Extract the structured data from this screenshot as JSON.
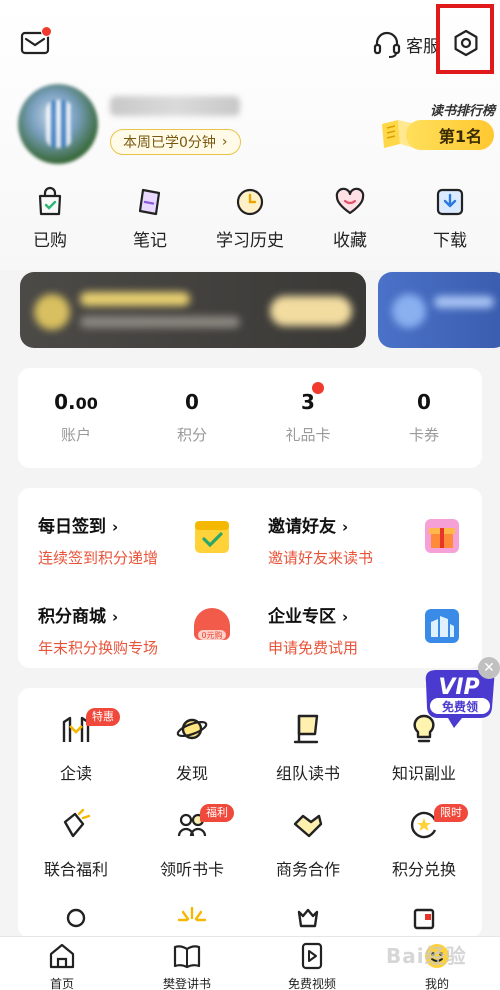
{
  "topbar": {
    "service_label": "客服"
  },
  "profile": {
    "study_time": "本周已学0分钟",
    "rank_title": "读书排行榜",
    "rank_value": "第1名"
  },
  "quick": [
    "已购",
    "笔记",
    "学习历史",
    "收藏",
    "下载"
  ],
  "account": [
    {
      "value_main": "0.",
      "value_dec": "00",
      "label": "账户"
    },
    {
      "value_main": "0",
      "value_dec": "",
      "label": "积分"
    },
    {
      "value_main": "3",
      "value_dec": "",
      "label": "礼品卡"
    },
    {
      "value_main": "0",
      "value_dec": "",
      "label": "卡券"
    }
  ],
  "features": [
    {
      "title": "每日签到",
      "subtitle": "连续签到积分递增"
    },
    {
      "title": "邀请好友",
      "subtitle": "邀请好友来读书"
    },
    {
      "title": "积分商城",
      "subtitle": "年末积分换购专场"
    },
    {
      "title": "企业专区",
      "subtitle": "申请免费试用"
    }
  ],
  "grid": [
    {
      "label": "企读",
      "tag": "特惠"
    },
    {
      "label": "发现",
      "tag": ""
    },
    {
      "label": "组队读书",
      "tag": ""
    },
    {
      "label": "知识副业",
      "tag": ""
    },
    {
      "label": "联合福利",
      "tag": ""
    },
    {
      "label": "领听书卡",
      "tag": "福利"
    },
    {
      "label": "商务合作",
      "tag": ""
    },
    {
      "label": "积分兑换",
      "tag": "限时"
    }
  ],
  "vip_float": {
    "line1": "VIP",
    "line2": "免费领"
  },
  "bottom_nav": [
    "首页",
    "樊登讲书",
    "免费视频",
    "我的"
  ],
  "watermark": "Bai经验",
  "colors": {
    "accent_red": "#f03a2e",
    "orange_text": "#e8543a",
    "gold": "#ffc830",
    "highlight": "#e01a1a"
  }
}
